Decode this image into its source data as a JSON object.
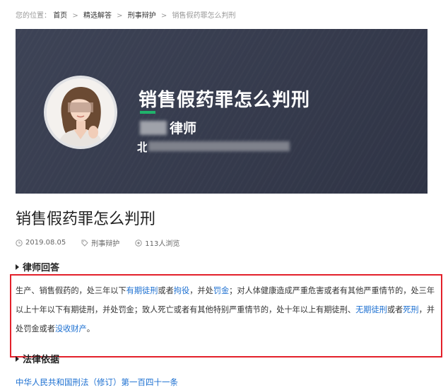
{
  "breadcrumb": {
    "prefix": "您的位置：",
    "separator": ">",
    "items": [
      "首页",
      "精选解答",
      "刑事辩护"
    ],
    "current": "销售假药罪怎么判刑"
  },
  "banner": {
    "title": "销售假药罪怎么判刑",
    "lawyer_role": "律师",
    "location_char": "北",
    "accent_color": "#20b36b",
    "background_color": "#3a3f52"
  },
  "article": {
    "title": "销售假药罪怎么判刑",
    "meta": {
      "date": "2019.08.05",
      "category": "刑事辩护",
      "views": "113人浏览"
    }
  },
  "answer_section": {
    "heading": "律师回答",
    "segments": [
      {
        "text": "生产、销售假药的，处三年以下",
        "link": false
      },
      {
        "text": "有期徒刑",
        "link": true
      },
      {
        "text": "或者",
        "link": false
      },
      {
        "text": "拘役",
        "link": true
      },
      {
        "text": "，并处",
        "link": false
      },
      {
        "text": "罚金",
        "link": true
      },
      {
        "text": "；对人体健康造成严重危害或者有其他严重情节的，处三年以上十年以下有期徒刑，并处罚金；致人死亡或者有其他特别严重情节的，处十年以上有期徒刑、",
        "link": false
      },
      {
        "text": "无期徒刑",
        "link": true
      },
      {
        "text": "或者",
        "link": false
      },
      {
        "text": "死刑",
        "link": true
      },
      {
        "text": "，并处罚金或者",
        "link": false
      },
      {
        "text": "没收财产",
        "link": true
      },
      {
        "text": "。",
        "link": false
      }
    ],
    "highlight_color": "#e3202a"
  },
  "law_section": {
    "heading": "法律依据",
    "link_text": "中华人民共和国刑法（修订）第一百四十一条"
  },
  "colors": {
    "link": "#1b6fd1",
    "text": "#333333"
  }
}
